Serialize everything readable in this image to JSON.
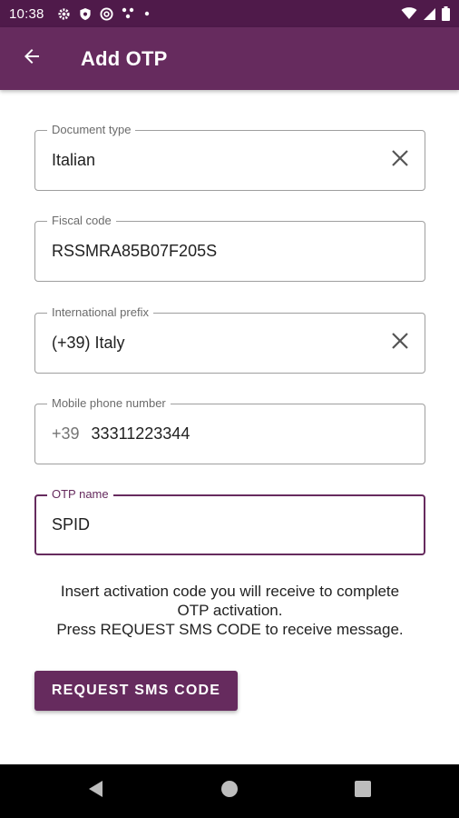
{
  "status_bar": {
    "time": "10:38",
    "icons_left": [
      "gear-icon",
      "shield-icon",
      "at-sign-icon",
      "dots-icon",
      "small-dot-icon"
    ],
    "icons_right": [
      "wifi-icon",
      "signal-icon",
      "battery-icon"
    ]
  },
  "app_bar": {
    "title": "Add OTP",
    "back_icon": "arrow-back-icon",
    "color": "#662b5e"
  },
  "form": {
    "document_type": {
      "label": "Document type",
      "value": "Italian",
      "clear_icon": "close-icon"
    },
    "fiscal_code": {
      "label": "Fiscal code",
      "value": "RSSMRA85B07F205S"
    },
    "international_prefix": {
      "label": "International prefix",
      "value": "(+39) Italy",
      "clear_icon": "close-icon"
    },
    "mobile_phone": {
      "label": "Mobile phone number",
      "prefix": "+39",
      "value": "33311223344"
    },
    "otp_name": {
      "label": "OTP name",
      "value": "SPID"
    }
  },
  "info": {
    "line1": "Insert activation code you will receive to complete",
    "line2": "OTP activation.",
    "line3": "Press REQUEST SMS CODE to receive message."
  },
  "actions": {
    "request_sms_label": "REQUEST SMS CODE"
  },
  "nav_bar": {
    "icons": [
      "nav-back-icon",
      "nav-home-icon",
      "nav-recents-icon"
    ]
  }
}
